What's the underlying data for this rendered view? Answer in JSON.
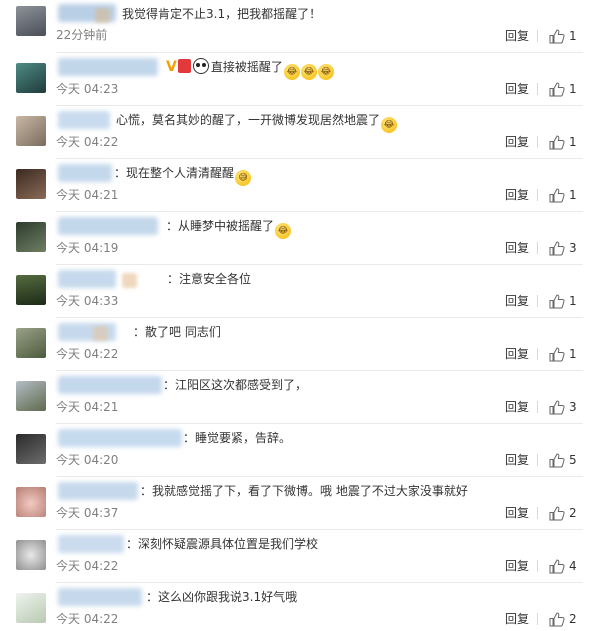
{
  "ui": {
    "reply_label": "回复",
    "like_icon": "thumbs-up-icon",
    "colors": {
      "text": "#333333",
      "meta": "#808080",
      "divider": "#e9e9e9"
    }
  },
  "comments": [
    {
      "text": "我觉得肯定不止3.1，把我都摇醒了！",
      "time": "22分钟前",
      "likes": "1"
    },
    {
      "text": "直接被摇醒了",
      "time": "今天 04:23",
      "likes": "1",
      "emojis": [
        "laugh-cry-emoji",
        "laugh-cry-emoji",
        "laugh-cry-emoji"
      ]
    },
    {
      "text": "心慌，莫名其妙的醒了，一开微博发现居然地震了",
      "time": "今天 04:22",
      "likes": "1",
      "emojis": [
        "laugh-cry-emoji"
      ]
    },
    {
      "text": "：现在整个人清清醒醒",
      "time": "今天 04:21",
      "likes": "1",
      "emojis": [
        "sweat-smile-emoji"
      ]
    },
    {
      "text": "：从睡梦中被摇醒了",
      "time": "今天 04:19",
      "likes": "3",
      "emojis": [
        "laugh-cry-emoji"
      ]
    },
    {
      "text": "：注意安全各位",
      "time": "今天 04:33",
      "likes": "1"
    },
    {
      "text": "：散了吧 同志们",
      "time": "今天 04:22",
      "likes": "1"
    },
    {
      "text": "：江阳区这次都感受到了，",
      "time": "今天 04:21",
      "likes": "3"
    },
    {
      "text": "：睡觉要紧，告辞。",
      "time": "今天 04:20",
      "likes": "5"
    },
    {
      "text": "：我就感觉摇了下，看了下微博。哦 地震了不过大家没事就好",
      "time": "今天 04:37",
      "likes": "2"
    },
    {
      "text": "：深刻怀疑震源具体位置是我们学校",
      "time": "今天 04:22",
      "likes": "4"
    },
    {
      "text": "：这么凶你跟我说3.1好气哦",
      "time": "今天 04:22",
      "likes": "2"
    }
  ]
}
